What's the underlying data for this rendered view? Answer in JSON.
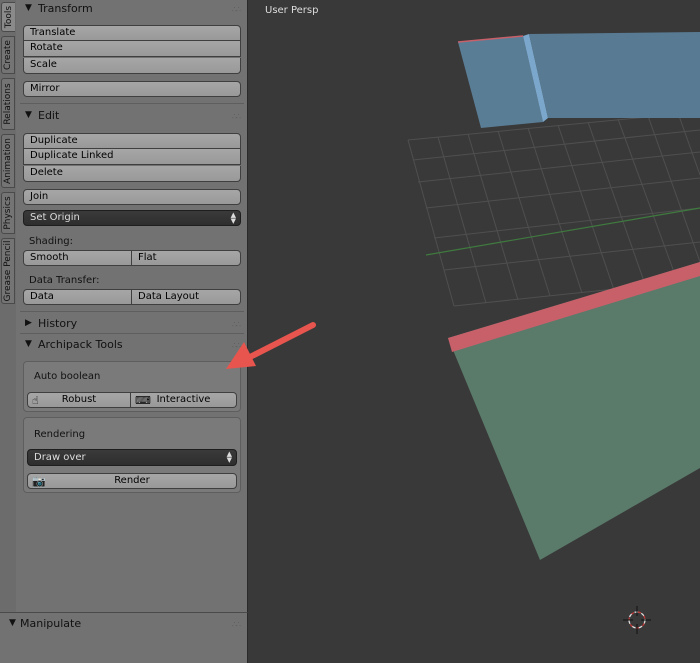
{
  "tabs": [
    "Tools",
    "Create",
    "Relations",
    "Animation",
    "Physics",
    "Grease Pencil"
  ],
  "panels": {
    "transform": {
      "title": "Transform",
      "buttons": [
        "Translate",
        "Rotate",
        "Scale"
      ],
      "mirror": "Mirror"
    },
    "edit": {
      "title": "Edit",
      "buttons": [
        "Duplicate",
        "Duplicate Linked",
        "Delete"
      ],
      "join": "Join",
      "set_origin": "Set Origin",
      "shading_label": "Shading:",
      "shading": [
        "Smooth",
        "Flat"
      ],
      "data_transfer_label": "Data Transfer:",
      "data_transfer": [
        "Data",
        "Data Layout"
      ]
    },
    "history": {
      "title": "History"
    },
    "archipack": {
      "title": "Archipack Tools",
      "auto_boolean_label": "Auto boolean",
      "robust": "Robust",
      "interactive": "Interactive",
      "rendering_label": "Rendering",
      "draw_over": "Draw over",
      "render": "Render"
    },
    "manipulate": {
      "title": "Manipulate"
    }
  },
  "viewport": {
    "label": "User Persp"
  },
  "icons": {
    "expanded": "triangle-down-icon",
    "collapsed": "triangle-right-icon",
    "robust": "hand-icon",
    "interactive": "mouse-icon",
    "render": "camera-icon",
    "cursor": "3d-cursor-icon"
  },
  "colors": {
    "panel_bg": "#727272",
    "viewport_bg": "#393939",
    "annotation_arrow": "#e8554e",
    "wall_top": "#5a7d96",
    "floor": "#5a7a6a",
    "selected_edge": "#c8606a"
  }
}
